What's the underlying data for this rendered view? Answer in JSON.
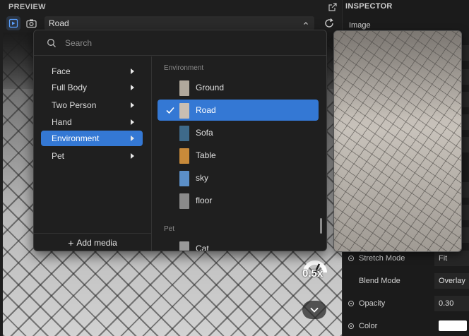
{
  "preview": {
    "title": "PREVIEW",
    "selected_media": "Road",
    "zoom": "0.5x"
  },
  "popup": {
    "search_placeholder": "Search",
    "categories": [
      {
        "label": "Face"
      },
      {
        "label": "Full Body"
      },
      {
        "label": "Two Person"
      },
      {
        "label": "Hand"
      },
      {
        "label": "Environment"
      },
      {
        "label": "Pet"
      }
    ],
    "selected_category": "Environment",
    "add_media_label": "Add media",
    "sections": [
      {
        "label": "Environment",
        "items": [
          {
            "label": "Ground",
            "thumb_color": "#b0a89c"
          },
          {
            "label": "Road",
            "thumb_color": "#c8beb2"
          },
          {
            "label": "Sofa",
            "thumb_color": "#3e6a8a"
          },
          {
            "label": "Table",
            "thumb_color": "#c88a3a"
          },
          {
            "label": "sky",
            "thumb_color": "#5b8fc8"
          },
          {
            "label": "floor",
            "thumb_color": "#8a8a8a"
          }
        ]
      },
      {
        "label": "Pet",
        "items": [
          {
            "label": "Cat",
            "thumb_color": "#9a9a9a"
          }
        ]
      }
    ],
    "selected_item": "Road"
  },
  "inspector": {
    "title": "INSPECTOR",
    "section": "Image",
    "properties": [
      {
        "name": "Stretch Mode",
        "value": "Fit"
      },
      {
        "name": "Blend Mode",
        "value": "Overlay"
      },
      {
        "name": "Opacity",
        "value": "0.30"
      },
      {
        "name": "Color",
        "value": ""
      }
    ]
  },
  "colors": {
    "accent": "#3478d4",
    "panel": "#1f1f1f",
    "color_swatch": "#ffffff"
  }
}
